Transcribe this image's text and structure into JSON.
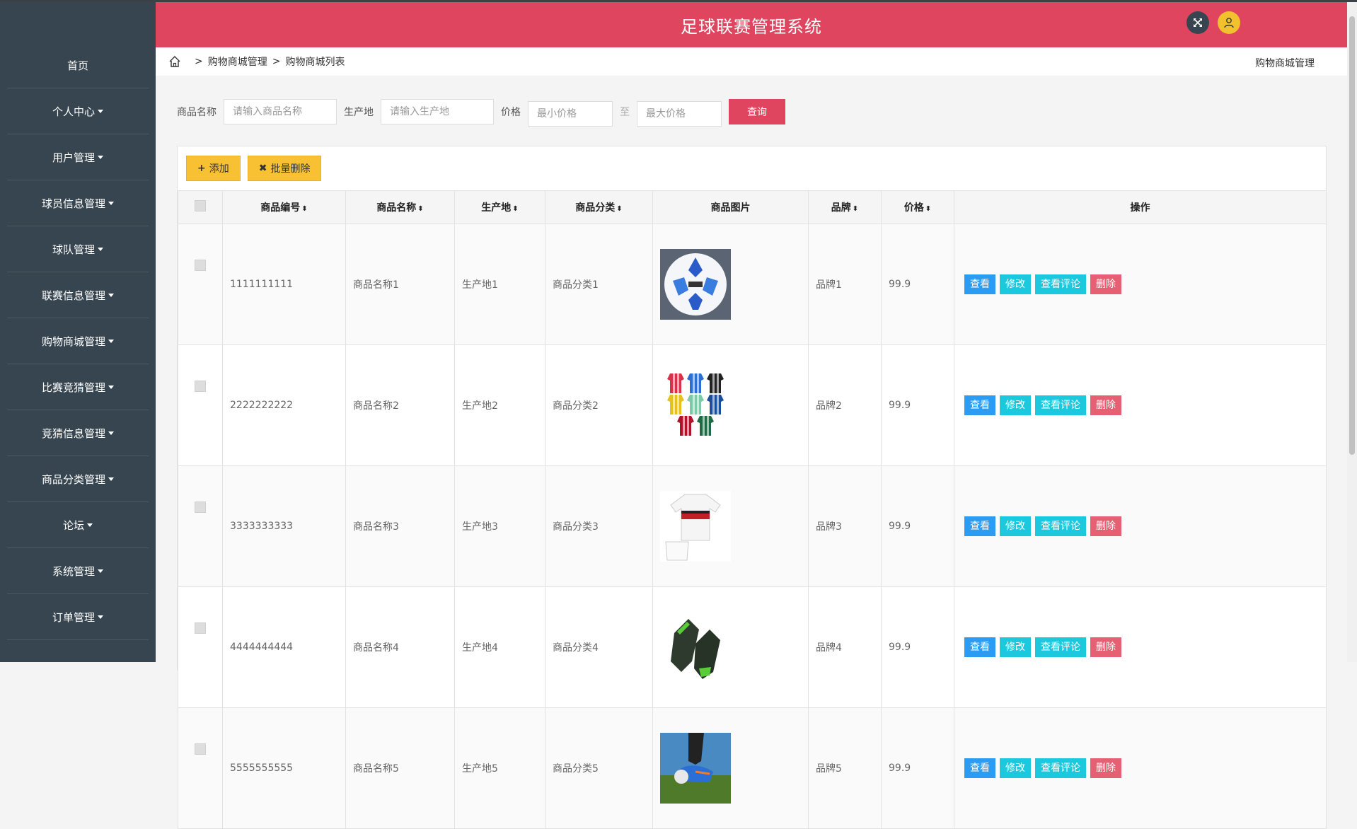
{
  "app": {
    "title": "足球联赛管理系统"
  },
  "sidebar": {
    "items": [
      {
        "label": "首页",
        "has_caret": false
      },
      {
        "label": "个人中心",
        "has_caret": true
      },
      {
        "label": "用户管理",
        "has_caret": true
      },
      {
        "label": "球员信息管理",
        "has_caret": true
      },
      {
        "label": "球队管理",
        "has_caret": true
      },
      {
        "label": "联赛信息管理",
        "has_caret": true
      },
      {
        "label": "购物商城管理",
        "has_caret": true
      },
      {
        "label": "比赛竞猜管理",
        "has_caret": true
      },
      {
        "label": "竞猜信息管理",
        "has_caret": true
      },
      {
        "label": "商品分类管理",
        "has_caret": true
      },
      {
        "label": "论坛",
        "has_caret": true
      },
      {
        "label": "系统管理",
        "has_caret": true
      },
      {
        "label": "订单管理",
        "has_caret": true
      }
    ]
  },
  "breadcrumb": {
    "sep": ">",
    "level1": "购物商城管理",
    "level2": "购物商城列表",
    "right": "购物商城管理"
  },
  "search": {
    "name_label": "商品名称",
    "name_placeholder": "请输入商品名称",
    "origin_label": "生产地",
    "origin_placeholder": "请输入生产地",
    "price_label": "价格",
    "min_placeholder": "最小价格",
    "to_label": "至",
    "max_placeholder": "最大价格",
    "query_label": "查询"
  },
  "toolbar": {
    "add_label": "添加",
    "batch_delete_label": "批量删除"
  },
  "table": {
    "headers": {
      "code": "商品编号",
      "name": "商品名称",
      "origin": "生产地",
      "category": "商品分类",
      "image": "商品图片",
      "brand": "品牌",
      "price": "价格",
      "ops": "操作"
    },
    "op_labels": {
      "view": "查看",
      "edit": "修改",
      "review": "查看评论",
      "delete": "删除"
    },
    "rows": [
      {
        "code": "1111111111",
        "name": "商品名称1",
        "origin": "生产地1",
        "category": "商品分类1",
        "image": "soccer-ball-image",
        "brand": "品牌1",
        "price": "99.9"
      },
      {
        "code": "2222222222",
        "name": "商品名称2",
        "origin": "生产地2",
        "category": "商品分类2",
        "image": "jerseys-image",
        "brand": "品牌2",
        "price": "99.9"
      },
      {
        "code": "3333333333",
        "name": "商品名称3",
        "origin": "生产地3",
        "category": "商品分类3",
        "image": "kit-image",
        "brand": "品牌3",
        "price": "99.9"
      },
      {
        "code": "4444444444",
        "name": "商品名称4",
        "origin": "生产地4",
        "category": "商品分类4",
        "image": "gloves-image",
        "brand": "品牌4",
        "price": "99.9"
      },
      {
        "code": "5555555555",
        "name": "商品名称5",
        "origin": "生产地5",
        "category": "商品分类5",
        "image": "boots-image",
        "brand": "品牌5",
        "price": "99.9"
      }
    ]
  },
  "colors": {
    "header": "#e0455f",
    "sidebar": "#36454f",
    "view": "#2b9cf2",
    "edit": "#1bc8dd",
    "delete": "#e46072",
    "toolbar": "#f7c133"
  }
}
